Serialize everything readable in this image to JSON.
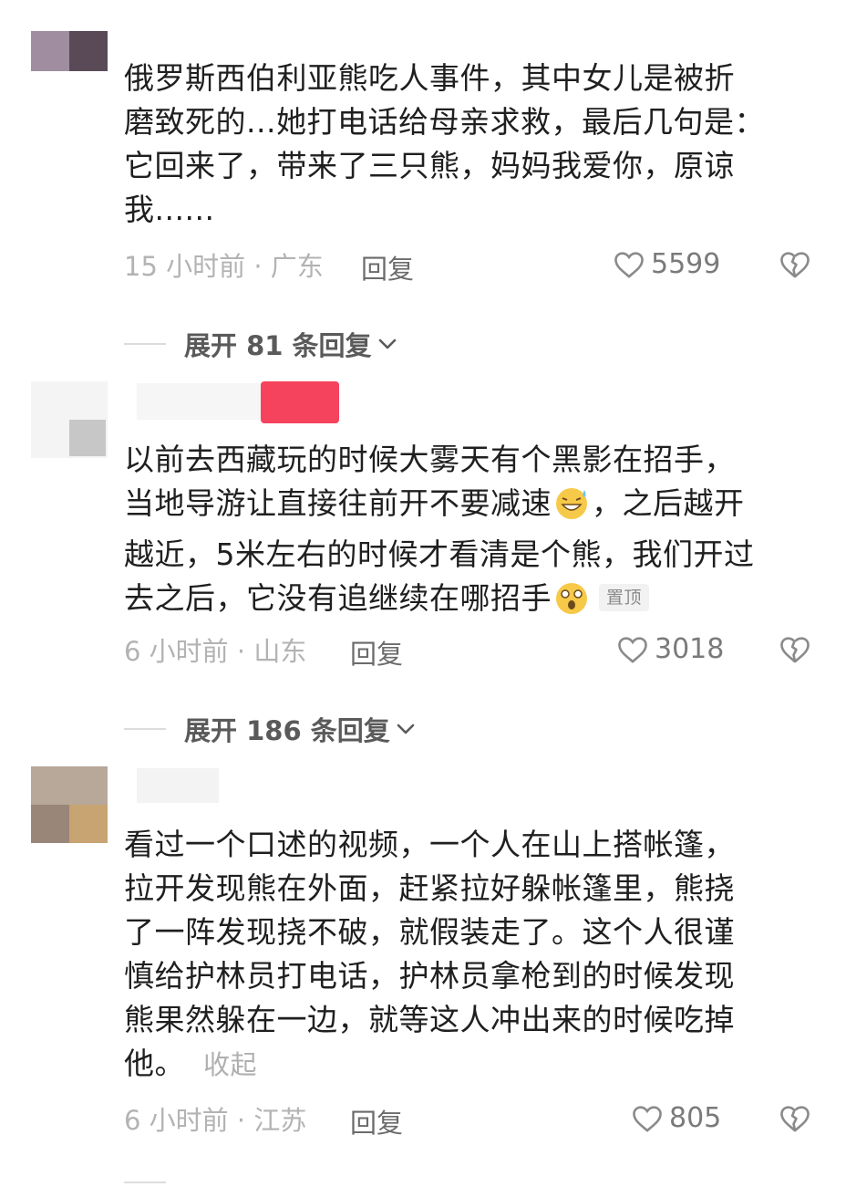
{
  "comments": [
    {
      "text_lines": [
        "俄罗斯西伯利亚熊吃人事件，其中女儿是被折",
        "磨致死的...她打电话给母亲求救，最后几句是：",
        "它回来了，带来了三只熊，妈妈我爱你，原谅",
        "我......"
      ],
      "time_location": "15 小时前 · 广东",
      "reply_label": "回复",
      "likes": "5599",
      "expand_label": "展开 81 条回复"
    },
    {
      "text_lines": [
        "以前去西藏玩的时候大雾天有个黑影在招手，",
        "当地导游让直接往前开不要减速",
        "，之后越开",
        "越近，5米左右的时候才看清是个熊，我们开过",
        "去之后，它没有追继续在哪招手"
      ],
      "pinned_label": "置顶",
      "time_location": "6 小时前 · 山东",
      "reply_label": "回复",
      "likes": "3018",
      "expand_label": "展开 186 条回复"
    },
    {
      "text_lines": [
        "看过一个口述的视频，一个人在山上搭帐篷，",
        "拉开发现熊在外面，赶紧拉好躲帐篷里，熊挠",
        "了一阵发现挠不破，就假装走了。这个人很谨",
        "慎给护林员打电话，护林员拿枪到的时候发现",
        "熊果然躲在一边，就等这人冲出来的时候吃掉",
        "他。"
      ],
      "collapse_label": "收起",
      "time_location": "6 小时前 · 江苏",
      "reply_label": "回复",
      "likes": "805"
    }
  ],
  "icons": {
    "like": "heart-outline-icon",
    "dislike": "broken-heart-icon",
    "expand": "chevron-down-icon",
    "emoji_1": "grinning-sweat-emoji",
    "emoji_2": "astonished-emoji"
  },
  "colors": {
    "text": "#1f1f1f",
    "meta": "#b3b3b3",
    "accent_badge": "#f5435d"
  }
}
